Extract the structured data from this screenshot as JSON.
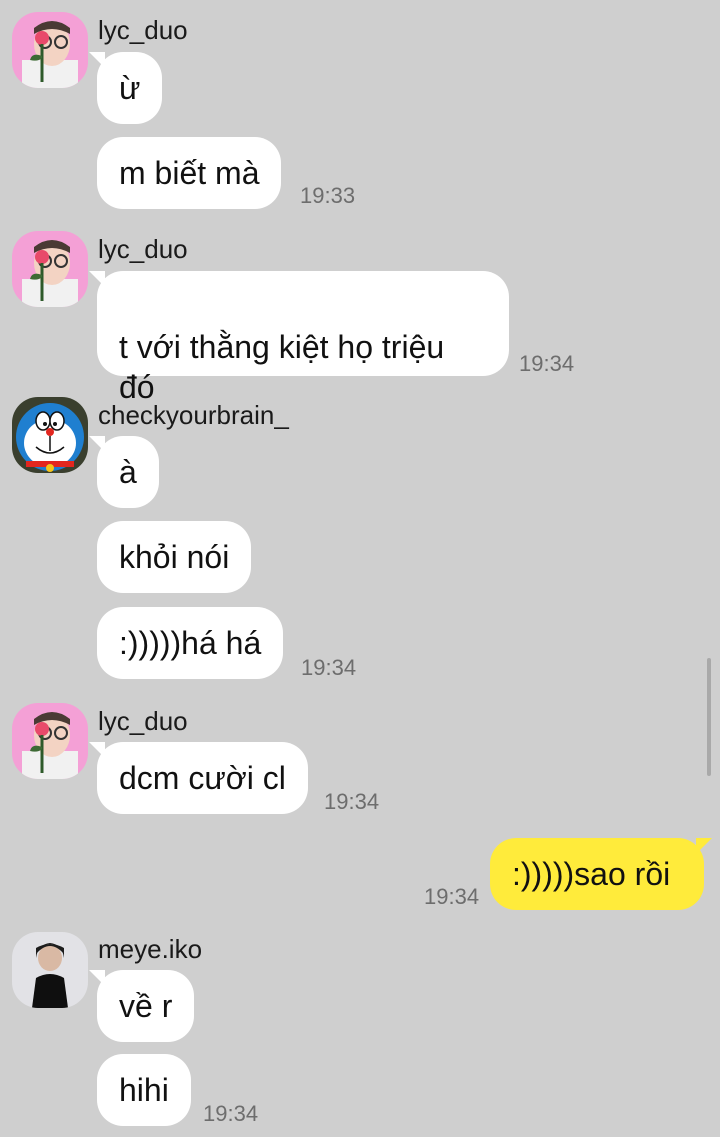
{
  "chat": {
    "messages": [
      {
        "sender": "lyc_duo",
        "avatar": "rose-portrait-avatar",
        "bubbles": [
          "ừ",
          "m biết mà"
        ],
        "time": "19:33"
      },
      {
        "sender": "lyc_duo",
        "avatar": "rose-portrait-avatar",
        "bubbles": [
          "t với thằng kiệt họ triệu\nđó"
        ],
        "time": "19:34"
      },
      {
        "sender": "checkyourbrain_",
        "avatar": "doraemon-avatar",
        "bubbles": [
          "à",
          "khỏi nói",
          ":)))))há há"
        ],
        "time": "19:34"
      },
      {
        "sender": "lyc_duo",
        "avatar": "rose-portrait-avatar",
        "bubbles": [
          "dcm cười cl"
        ],
        "time": "19:34"
      },
      {
        "sender": "",
        "mine": true,
        "bubbles": [
          ":)))))sao rồi"
        ],
        "time": "19:34"
      },
      {
        "sender": "meye.iko",
        "avatar": "dark-portrait-avatar",
        "bubbles": [
          "về r",
          "hihi"
        ],
        "time": "19:34"
      }
    ]
  },
  "colors": {
    "background": "#cfcfcf",
    "bubble_other": "#ffffff",
    "bubble_mine": "#ffeb3b",
    "time_text": "#6d6d6d"
  }
}
